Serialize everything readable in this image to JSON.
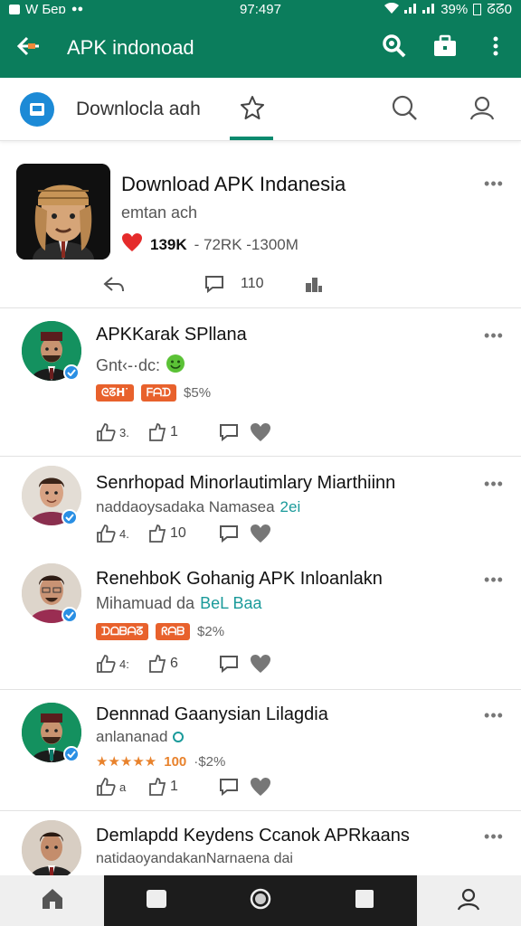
{
  "status_bar": {
    "left_text": "W Ƃeɒ",
    "time": "97:497",
    "battery": "39%",
    "right_text": "ᘔᘔ0"
  },
  "app_bar": {
    "title": "APK indonoad"
  },
  "tab_bar": {
    "app_label": "Downlocla aɑh"
  },
  "featured": {
    "title": "Download APK Indanesia",
    "subtitle": "emtan ach",
    "likes": "139K",
    "stats": "- 72RK -1300M",
    "comment_count": "110"
  },
  "posts": [
    {
      "title": "APKKarak SPllana",
      "subtitle": "Gnt‹-·dc:",
      "badges": [
        "ᘓᘔᕼᐝ",
        "ᖴᗩᗪ"
      ],
      "meta": "$5%",
      "likes": "3.",
      "reposts": "1"
    },
    {
      "title": "Senrhopad Minorlautimlary Miarthiinn",
      "subtitle": "naddaoysadaka Namasea",
      "subtitle_highlight": "2ei",
      "likes": "4.",
      "reposts": "10"
    },
    {
      "title": "RenehboK Gohanig APK Inloanlakn",
      "subtitle": "Mihamuad da",
      "subtitle_highlight": "BeL Baa",
      "badges": [
        "ᗪᗝᗷᗩᘔ",
        "ᖇᗩᗷ"
      ],
      "meta": "$2%",
      "likes": "4:",
      "reposts": "6"
    },
    {
      "title": "Dennnad Gaanysian Lilagdia",
      "subtitle": "anlananad",
      "rating_stars": "★★★★★",
      "rating_count": "100",
      "meta": "·$2%",
      "likes": "a",
      "reposts": "1"
    },
    {
      "title": "Demlapdd Keydens Ccanok APRkaans",
      "subtitle": "natidaoyandakanNarnaena dai"
    }
  ],
  "colors": {
    "brand": "#0b7d5c",
    "accent_tab": "#0b8a6e",
    "badge": "#e8612c",
    "verified": "#2a8fe4",
    "like_red": "#e52b2b"
  }
}
